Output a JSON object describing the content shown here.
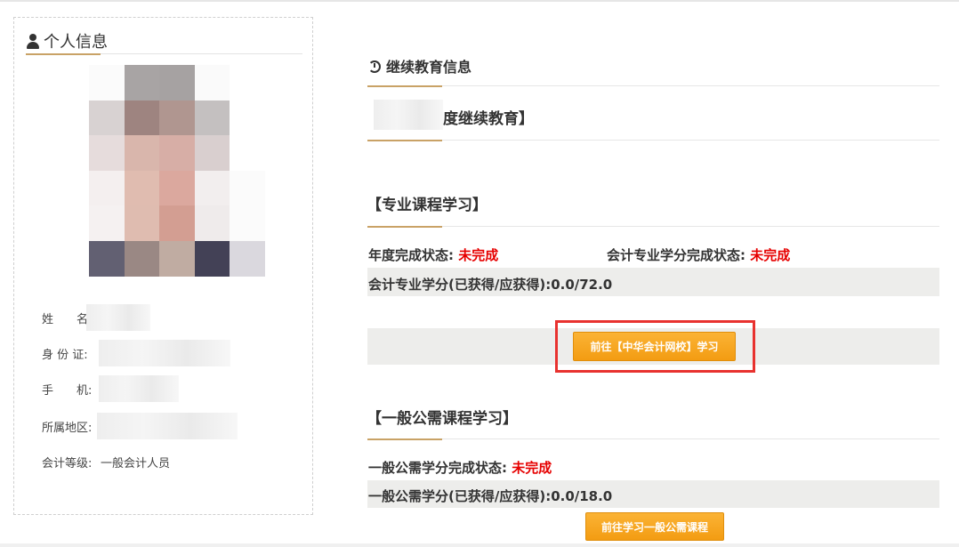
{
  "personal": {
    "title": "个人信息",
    "icon": "user-icon",
    "fields": [
      {
        "label": "姓　　名:",
        "value": ""
      },
      {
        "label": "身 份 证:",
        "value": ""
      },
      {
        "label": "手　　机:",
        "value": ""
      },
      {
        "label": "所属地区:",
        "value": ""
      },
      {
        "label": "会计等级:",
        "value": "一般会计人员"
      }
    ]
  },
  "education": {
    "title": "继续教育信息",
    "icon": "history-icon",
    "year_title": "度继续教育】"
  },
  "professional": {
    "title": "【专业课程学习】",
    "annual_status_label": "年度完成状态:",
    "annual_status_value": "未完成",
    "credit_status_label": "会计专业学分完成状态:",
    "credit_status_value": "未完成",
    "credits_text": "会计专业学分(已获得/应获得):0.0/72.0",
    "button_label": "前往【中华会计网校】学习"
  },
  "general": {
    "title": "【一般公需课程学习】",
    "status_label": "一般公需学分完成状态:",
    "status_value": "未完成",
    "credits_text": "一般公需学分(已获得/应获得):0.0/18.0",
    "button_label": "前往学习一般公需课程"
  },
  "colors": {
    "accent": "#c9a266",
    "status_red": "#e60000",
    "button_orange": "#f39c12",
    "highlight_red": "#e8322f"
  }
}
